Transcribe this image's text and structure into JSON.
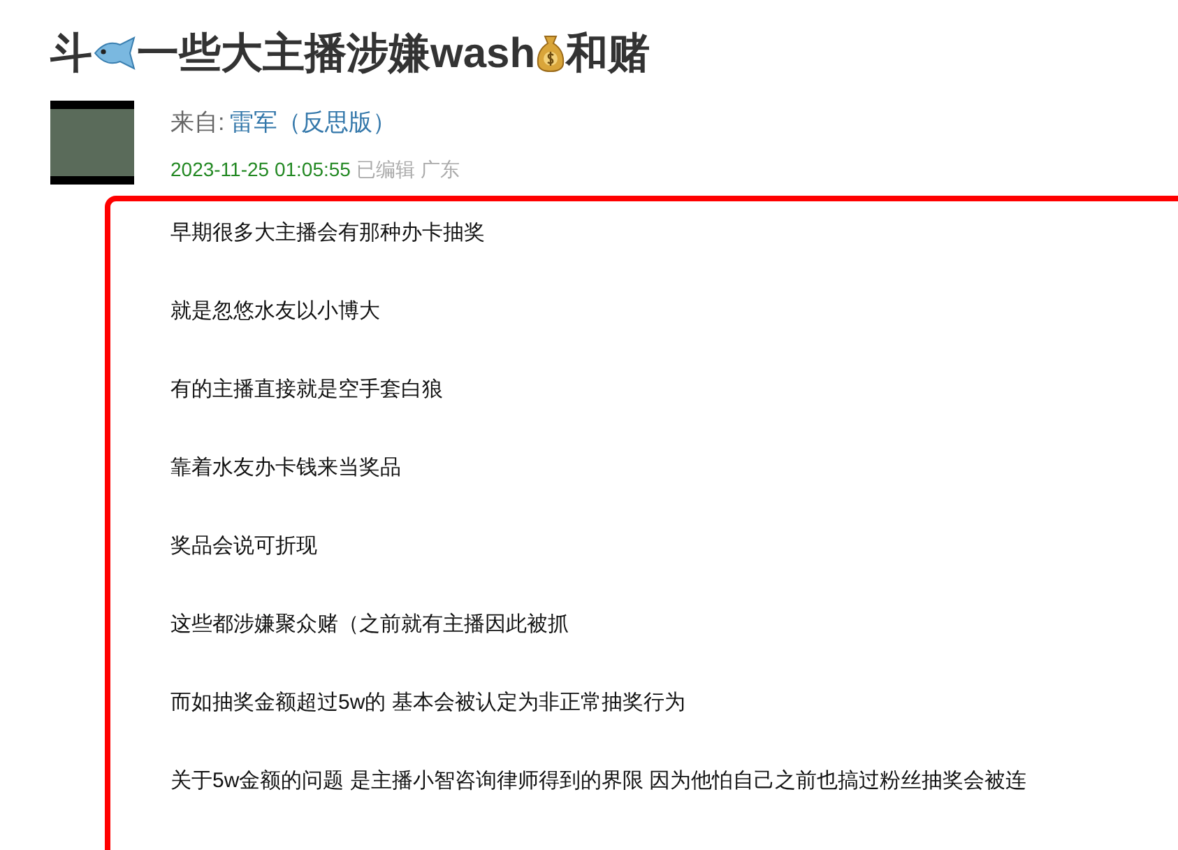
{
  "title": [
    {
      "kind": "text",
      "text": "斗"
    },
    {
      "kind": "fish"
    },
    {
      "kind": "text",
      "text": "一些大主播涉嫌wash"
    },
    {
      "kind": "moneybag"
    },
    {
      "kind": "text",
      "text": "和赌"
    }
  ],
  "author": {
    "label": "来自:",
    "name": "雷军（反思版）"
  },
  "meta": {
    "time": "2023-11-25 01:05:55",
    "edited": "已编辑",
    "location": "广东"
  },
  "content": [
    "早期很多大主播会有那种办卡抽奖",
    "就是忽悠水友以小博大",
    "有的主播直接就是空手套白狼",
    "靠着水友办卡钱来当奖品",
    "奖品会说可折现",
    "这些都涉嫌聚众赌（之前就有主播因此被抓",
    "而如抽奖金额超过5w的 基本会被认定为非正常抽奖行为",
    "关于5w金额的问题 是主播小智咨询律师得到的界限 因为他怕自己之前也搞过粉丝抽奖会被连"
  ]
}
